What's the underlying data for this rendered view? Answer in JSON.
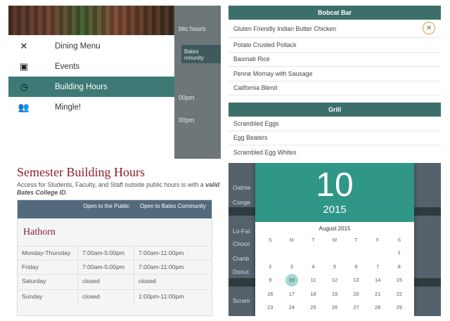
{
  "drawer": {
    "peek_text_1": "blic hours",
    "peek_text_2": "Bates nmunity",
    "peek_times": [
      "00pm",
      "00pm"
    ],
    "menu": [
      {
        "label": "Dining Menu",
        "icon": "fork-knife-icon",
        "glyph": "✕"
      },
      {
        "label": "Events",
        "icon": "calendar-icon",
        "glyph": "▣"
      },
      {
        "label": "Building Hours",
        "icon": "clock-icon",
        "glyph": "◷",
        "active": true
      },
      {
        "label": "Mingle!",
        "icon": "people-icon",
        "glyph": "👥"
      }
    ]
  },
  "dining": {
    "section1": "Bobcat Bar",
    "items1": [
      "Gluten Friendly Indian Butter Chicken",
      "Potato Crusted Pollack",
      "Basmati Rice",
      "Penne Mornay with Sausage",
      "California Blend"
    ],
    "section2": "Grill",
    "items2": [
      "Scrambled Eggs",
      "Egg Beaters",
      "Scrambled Egg Whites"
    ],
    "badge_glyph": "✕"
  },
  "hours": {
    "title": "Semester Building Hours",
    "subtitle_pre": "Access for Students, Faculty, and Staff outside public hours is with a ",
    "subtitle_bold": "valid Bates College ID",
    "subtitle_post": ".",
    "col_public": "Open to the Public",
    "col_community": "Open to Bates Community",
    "hall": "Hathorn",
    "rows": [
      {
        "day": "Monday-Thursday",
        "public": "7:00am-5:00pm",
        "community": "7:00am-11:00pm"
      },
      {
        "day": "Friday",
        "public": "7:00am-5:00pm",
        "community": "7:00am-11:00pm"
      },
      {
        "day": "Saturday",
        "public": "closed",
        "community": "closed"
      },
      {
        "day": "Sunday",
        "public": "closed",
        "community": "1:00pm-11:00pm"
      }
    ]
  },
  "datepicker": {
    "day": "10",
    "year": "2015",
    "month_label": "August 2015",
    "weekdays": [
      "S",
      "M",
      "T",
      "W",
      "T",
      "F",
      "S"
    ],
    "cells": [
      "",
      "",
      "",
      "",
      "",
      "",
      "1",
      "2",
      "3",
      "4",
      "5",
      "6",
      "7",
      "8",
      "9",
      "10",
      "11",
      "12",
      "13",
      "14",
      "15",
      "16",
      "17",
      "18",
      "19",
      "20",
      "21",
      "22",
      "23",
      "24",
      "25",
      "26",
      "27",
      "28",
      "29"
    ],
    "selected": "10",
    "bg_items": [
      "Oatme",
      "Conge",
      "Lo-Fat",
      "Choco",
      "Cranb",
      "Donut",
      "Scram"
    ]
  }
}
